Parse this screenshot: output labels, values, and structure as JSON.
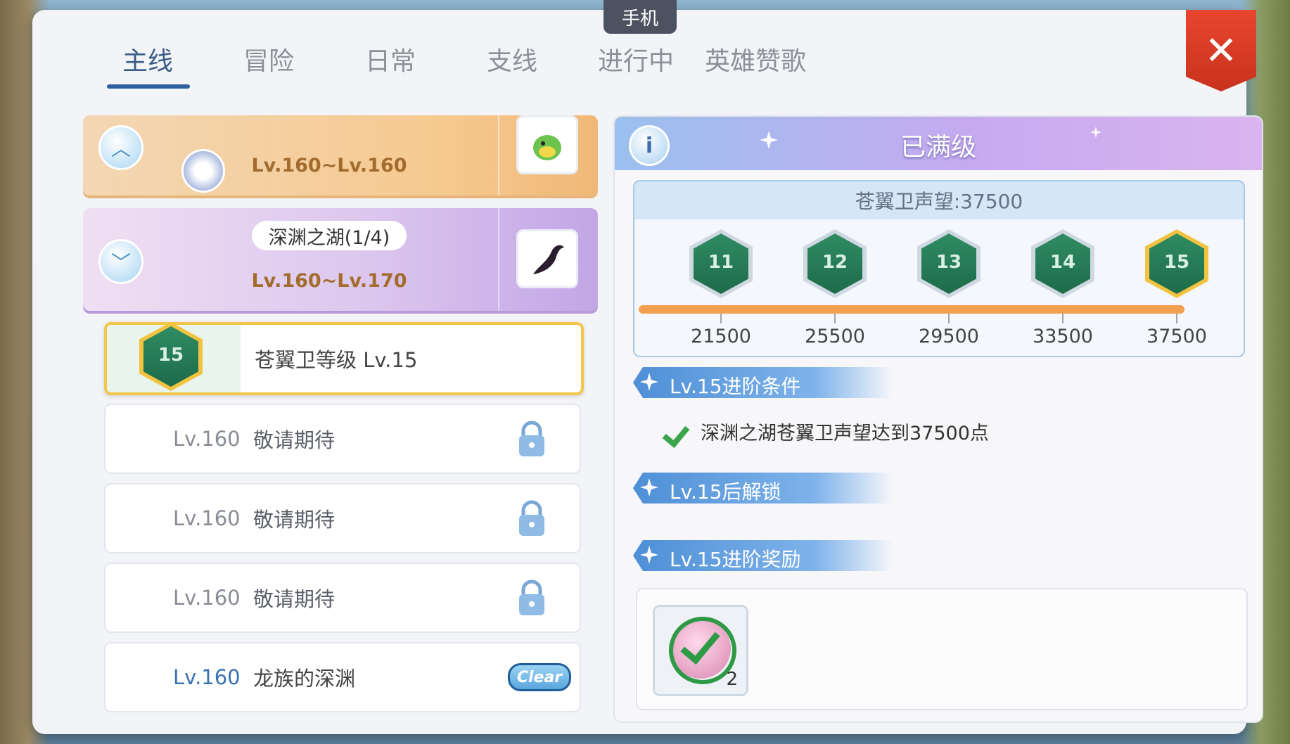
{
  "device_tag": "手机",
  "tabs": [
    {
      "label": "主线",
      "active": true
    },
    {
      "label": "冒险",
      "active": false
    },
    {
      "label": "日常",
      "active": false
    },
    {
      "label": "支线",
      "active": false
    },
    {
      "label": "进行中",
      "active": false
    },
    {
      "label": "英雄赞歌",
      "active": false
    }
  ],
  "close_icon": "✕",
  "chapters": {
    "previous": {
      "level": "Lv.160~Lv.160",
      "icon": "green-dragon-icon"
    },
    "current": {
      "title": "深渊之湖(1/4)",
      "level": "Lv.160~Lv.170",
      "icon": "dark-tentacle-icon"
    }
  },
  "quests": {
    "selected": {
      "badge": "15",
      "name": "苍翼卫等级 Lv.15"
    },
    "locked": [
      {
        "level": "Lv.160",
        "name": "敬请期待"
      },
      {
        "level": "Lv.160",
        "name": "敬请期待"
      },
      {
        "level": "Lv.160",
        "name": "敬请期待"
      }
    ],
    "completed": {
      "level": "Lv.160",
      "name": "龙族的深渊",
      "status": "Clear"
    }
  },
  "detail": {
    "info_icon": "i",
    "header": "已满级",
    "reputation_title": "苍翼卫声望:37500",
    "medals": [
      {
        "rank": "11",
        "value": "21500",
        "current": false
      },
      {
        "rank": "12",
        "value": "25500",
        "current": false
      },
      {
        "rank": "13",
        "value": "29500",
        "current": false
      },
      {
        "rank": "14",
        "value": "33500",
        "current": false
      },
      {
        "rank": "15",
        "value": "37500",
        "current": true
      }
    ],
    "reputation_progress": 1.0,
    "sections": {
      "conditions": "Lv.15进阶条件",
      "unlocks": "Lv.15后解锁",
      "rewards": "Lv.15进阶奖励"
    },
    "condition_text": "深渊之湖苍翼卫声望达到37500点",
    "reward": {
      "count": "2",
      "claimed": true
    }
  },
  "colors": {
    "accent_blue": "#2f5f9e",
    "close_red": "#e8452e",
    "progress_orange": "#f3a050",
    "medal_green": "#2f8c63",
    "selected_border": "#f1c64a"
  }
}
